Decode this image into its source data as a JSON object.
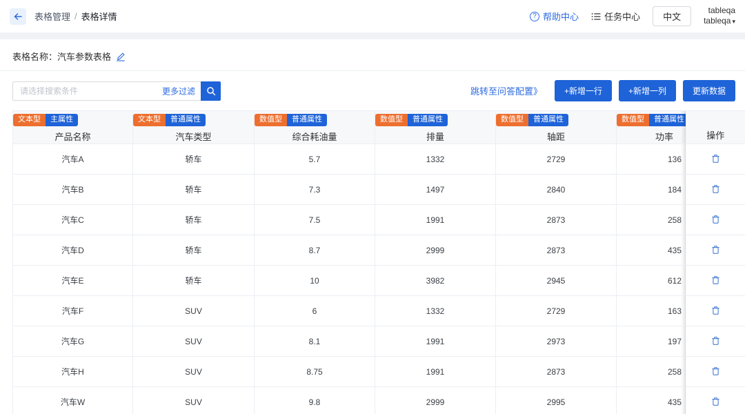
{
  "topbar": {
    "breadcrumb": {
      "parent": "表格管理",
      "separator": "/",
      "current": "表格详情"
    },
    "help_center": "帮助中心",
    "task_center": "任务中心",
    "language": "中文",
    "account": {
      "line1": "tableqa",
      "line2": "tableqa"
    }
  },
  "table_info": {
    "label": "表格名称：",
    "name": "汽车参数表格"
  },
  "toolbar": {
    "search_placeholder": "请选择搜索条件",
    "more_filter": "更多过滤",
    "qa_link": "跳转至问答配置》",
    "add_row": "+新增一行",
    "add_column": "+新增一列",
    "update_data": "更新数据"
  },
  "table": {
    "columns": [
      {
        "type": "文本型",
        "attr": "主属性",
        "label": "产品名称",
        "align": "center"
      },
      {
        "type": "文本型",
        "attr": "普通属性",
        "label": "汽车类型",
        "align": "center"
      },
      {
        "type": "数值型",
        "attr": "普通属性",
        "label": "综合耗油量",
        "align": "center"
      },
      {
        "type": "数值型",
        "attr": "普通属性",
        "label": "排量",
        "align": "center"
      },
      {
        "type": "数值型",
        "attr": "普通属性",
        "label": "轴距",
        "align": "center"
      },
      {
        "type": "数值型",
        "attr": "普通属性",
        "label": "功率",
        "align": "right"
      }
    ],
    "action_header": "操作",
    "rows": [
      [
        "汽车A",
        "轿车",
        "5.7",
        "1332",
        "2729",
        "136"
      ],
      [
        "汽车B",
        "轿车",
        "7.3",
        "1497",
        "2840",
        "184"
      ],
      [
        "汽车C",
        "轿车",
        "7.5",
        "1991",
        "2873",
        "258"
      ],
      [
        "汽车D",
        "轿车",
        "8.7",
        "2999",
        "2873",
        "435"
      ],
      [
        "汽车E",
        "轿车",
        "10",
        "3982",
        "2945",
        "612"
      ],
      [
        "汽车F",
        "SUV",
        "6",
        "1332",
        "2729",
        "163"
      ],
      [
        "汽车G",
        "SUV",
        "8.1",
        "1991",
        "2973",
        "197"
      ],
      [
        "汽车H",
        "SUV",
        "8.75",
        "1991",
        "2873",
        "258"
      ],
      [
        "汽车W",
        "SUV",
        "9.8",
        "2999",
        "2995",
        "435"
      ]
    ]
  },
  "colors": {
    "primary_blue": "#1e63d8",
    "link_blue": "#2e6ce0",
    "badge_orange": "#ed6f2f",
    "badge_blue": "#1e63d8",
    "header_bg": "#f7f8fa",
    "table_border": "#ebeef3",
    "icon_blue": "#4a7fd6"
  }
}
